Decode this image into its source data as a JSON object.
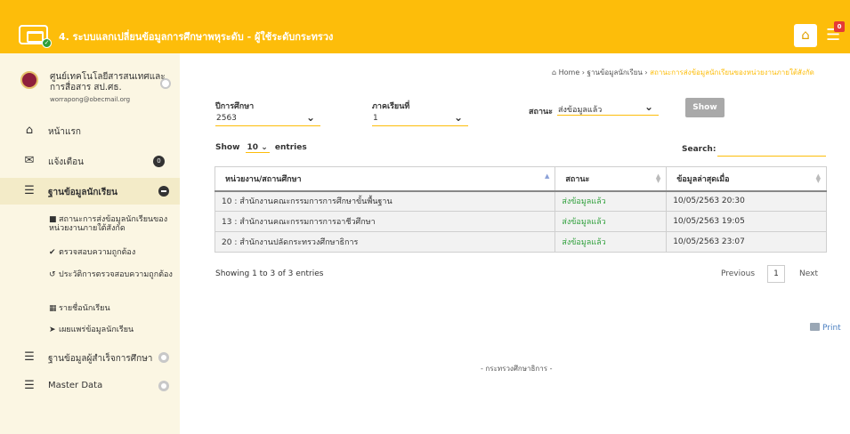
{
  "header": {
    "title": "4. ระบบแลกเปลี่ยนข้อมูลการศึกษาพหุระดับ - ผู้ใช้ระดับกระทรวง",
    "notifications_count": "0",
    "brand_color": "#fdbd0a"
  },
  "sidebar": {
    "org_name": "ศูนย์เทคโนโลยีสารสนเทศและการสื่อสาร สป.ศธ.",
    "org_email": "worrapong@obecmail.org",
    "items": [
      {
        "label": "หน้าแรก",
        "icon": "home-icon"
      },
      {
        "label": "แจ้งเตือน",
        "icon": "envelope-icon",
        "badge": "0"
      },
      {
        "label": "ฐานข้อมูลนักเรียน",
        "icon": "database-icon",
        "active": true
      },
      {
        "label": "ฐานข้อมูลผู้สำเร็จการศึกษา",
        "icon": "database-icon"
      },
      {
        "label": "Master Data",
        "icon": "database-icon"
      }
    ],
    "subitems": [
      {
        "label": "สถานะการส่งข้อมูลนักเรียนของหน่วยงานภายใต้สังกัด",
        "icon": "square-icon"
      },
      {
        "label": "ตรวจสอบความถูกต้อง",
        "icon": "check-icon"
      },
      {
        "label": "ประวัติการตรวจสอบความถูกต้อง",
        "icon": "history-icon"
      },
      {
        "label": "รายชื่อนักเรียน",
        "icon": "table-icon"
      },
      {
        "label": "เผยแพร่ข้อมูลนักเรียน",
        "icon": "send-icon"
      }
    ]
  },
  "breadcrumb": {
    "home": "Home",
    "section": "ฐานข้อมูลนักเรียน",
    "current": "สถานะการส่งข้อมูลนักเรียนของหน่วยงานภายใต้สังกัด"
  },
  "filters": {
    "year_label": "ปีการศึกษา",
    "year_value": "2563",
    "term_label": "ภาคเรียนที่",
    "term_value": "1",
    "status_label": "สถานะ",
    "status_value": "ส่งข้อมูลแล้ว",
    "show_button": "Show"
  },
  "table_controls": {
    "show_prefix": "Show",
    "page_length": "10",
    "show_suffix": "entries",
    "search_label": "Search:",
    "search_value": ""
  },
  "table": {
    "columns": [
      "หน่วยงาน/สถานศึกษา",
      "สถานะ",
      "ข้อมูลล่าสุดเมื่อ"
    ],
    "rows": [
      [
        "10 : สำนักงานคณะกรรมการการศึกษาขั้นพื้นฐาน",
        "ส่งข้อมูลแล้ว",
        "10/05/2563 20:30"
      ],
      [
        "13 : สำนักงานคณะกรรมการการอาชีวศึกษา",
        "ส่งข้อมูลแล้ว",
        "10/05/2563 19:05"
      ],
      [
        "20 : สำนักงานปลัดกระทรวงศึกษาธิการ",
        "ส่งข้อมูลแล้ว",
        "10/05/2563 23:07"
      ]
    ]
  },
  "pagination": {
    "info": "Showing 1 to 3 of 3 entries",
    "previous": "Previous",
    "page": "1",
    "next": "Next"
  },
  "print_label": "Print",
  "footer": "- กระทรวงศึกษาธิการ -"
}
